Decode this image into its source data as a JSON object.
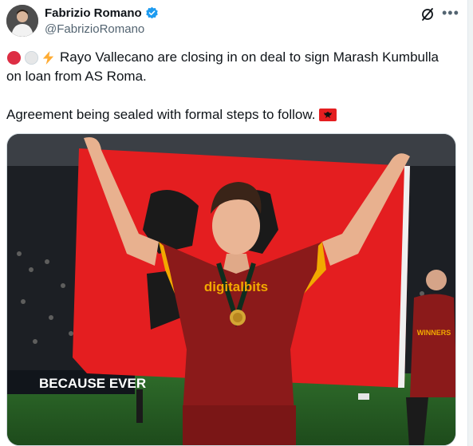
{
  "author": {
    "display_name": "Fabrizio Romano",
    "handle": "@FabrizioRomano",
    "verified": true
  },
  "header_icons": [
    "grok-icon",
    "more-icon"
  ],
  "tweet": {
    "line1": "Rayo Vallecano are closing in on deal to sign Marash Kumbulla",
    "line2": "on loan from AS Roma.",
    "line3": "Agreement being sealed with formal steps to follow.",
    "emojis_prefix": [
      "red-circle-icon",
      "white-circle-icon",
      "lightning-icon"
    ],
    "emoji_suffix": "albania-flag-icon"
  },
  "media": {
    "shirt_sponsor": "digitalbits",
    "banner_text": "BECAUSE EVER",
    "shirt_text": "WINNERS"
  },
  "colors": {
    "accent": "#1d9bf0",
    "flag_red": "#e41e20",
    "shirt": "#8b1a1a"
  }
}
